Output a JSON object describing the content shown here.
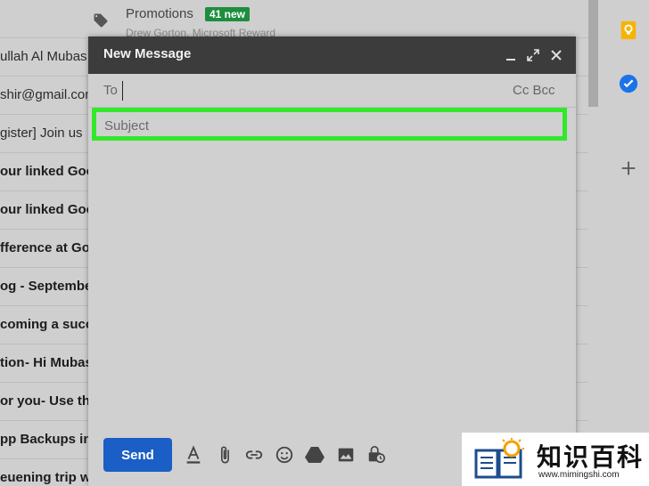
{
  "inbox": {
    "promotions": {
      "title": "Promotions",
      "badge": "41 new",
      "senders": "Drew Gorton, Microsoft Reward"
    },
    "rows": [
      {
        "text": "ullah Al Mubas",
        "bold": false
      },
      {
        "text": "shir@gmail.con",
        "bold": false
      },
      {
        "text": "gister] Join us",
        "bold": false
      },
      {
        "text": "our linked Goo",
        "bold": true
      },
      {
        "text": "our linked Goo",
        "bold": true
      },
      {
        "text": "fference at Goo",
        "bold": true
      },
      {
        "text": "og - Septembe",
        "bold": true
      },
      {
        "text": "coming a succ",
        "bold": true
      },
      {
        "text": "tion",
        "suffix": " - Hi Mubas",
        "bold": true
      },
      {
        "text": "or you",
        "suffix": " - Use this",
        "bold": true
      },
      {
        "text": "pp Backups in",
        "bold": true
      },
      {
        "text": "euening trip wit",
        "bold": true
      }
    ]
  },
  "compose": {
    "title": "New Message",
    "to_label": "To",
    "cc_bcc": "Cc Bcc",
    "subject_placeholder": "Subject",
    "send_label": "Send",
    "tools": [
      "format-text-icon",
      "attach-icon",
      "link-icon",
      "emoji-icon",
      "drive-icon",
      "photo-icon",
      "confidential-icon"
    ]
  },
  "rail": {
    "icons": [
      "keep-icon",
      "tasks-icon",
      "add-icon"
    ]
  },
  "watermark": {
    "cn": "知识百科",
    "url": "www.mimingshi.com"
  },
  "colors": {
    "highlight": "#33e82a",
    "send": "#1a5ec6",
    "header": "#3c3c3c",
    "badge": "#1e8e3e"
  }
}
